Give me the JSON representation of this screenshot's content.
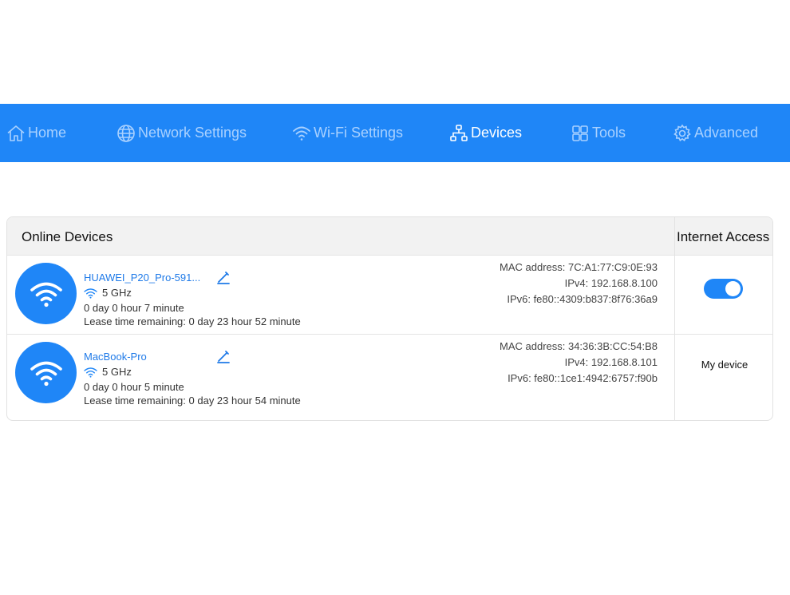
{
  "nav": {
    "items": [
      {
        "label": "Home",
        "icon": "home-icon"
      },
      {
        "label": "Network Settings",
        "icon": "globe-icon"
      },
      {
        "label": "Wi-Fi Settings",
        "icon": "wifi-icon"
      },
      {
        "label": "Devices",
        "icon": "devices-icon",
        "active": true
      },
      {
        "label": "Tools",
        "icon": "tools-icon"
      },
      {
        "label": "Advanced",
        "icon": "gear-icon"
      }
    ]
  },
  "table": {
    "header_devices": "Online Devices",
    "header_access": "Internet Access",
    "devices": [
      {
        "name": "HUAWEI_P20_Pro-591...",
        "band": "5 GHz",
        "online_time": "0 day 0 hour 7 minute",
        "lease": "Lease time remaining: 0 day 23 hour 52 minute",
        "mac": "MAC address: 7C:A1:77:C9:0E:93",
        "ipv4": "IPv4: 192.168.8.100",
        "ipv6": "IPv6: fe80::4309:b837:8f76:36a9",
        "internet_access_enabled": true
      },
      {
        "name": "MacBook-Pro",
        "band": "5 GHz",
        "online_time": "0 day 0 hour 5 minute",
        "lease": "Lease time remaining: 0 day 23 hour 54 minute",
        "mac": "MAC address: 34:36:3B:CC:54:B8",
        "ipv4": "IPv4: 192.168.8.101",
        "ipv6": "IPv6: fe80::1ce1:4942:6757:f90b",
        "access_label": "My device"
      }
    ]
  },
  "colors": {
    "primary": "#1f86f7",
    "nav_inactive": "#a9d1ff",
    "link": "#1f7ae8"
  }
}
